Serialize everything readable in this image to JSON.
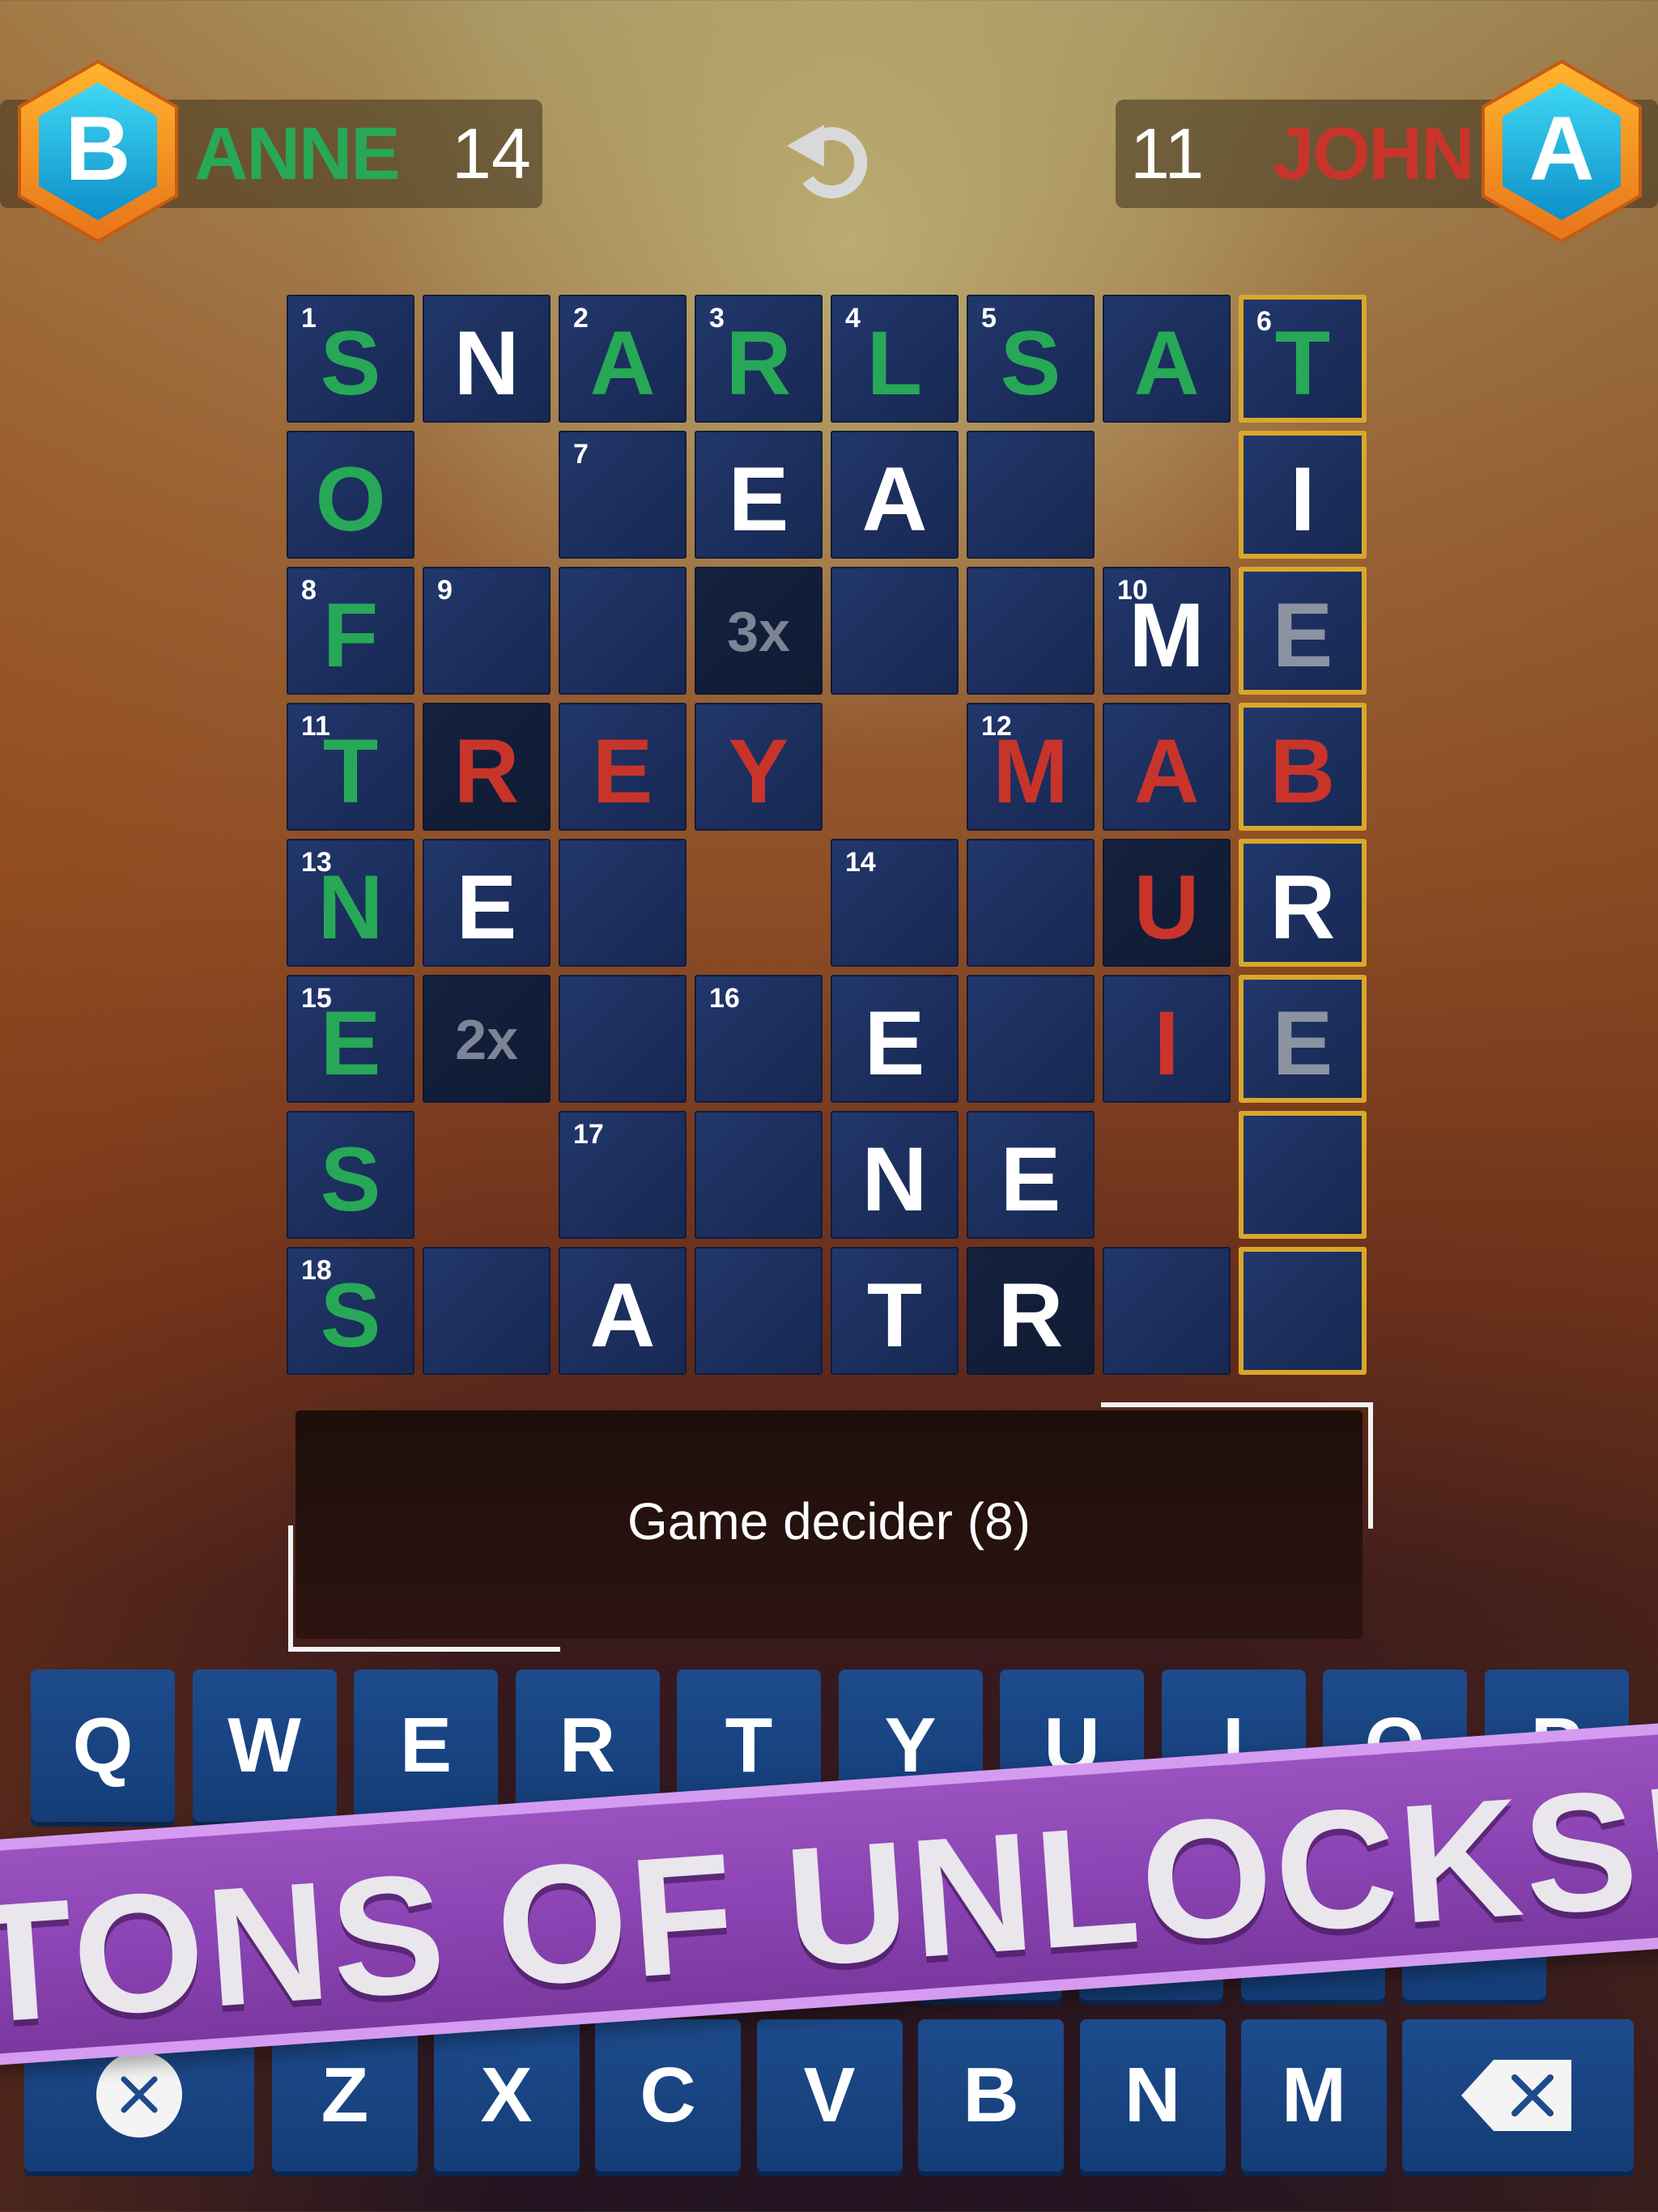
{
  "players": {
    "left": {
      "badge": "B",
      "name": "ANNE",
      "score": "14",
      "color": "#27a857"
    },
    "right": {
      "badge": "A",
      "name": "JOHN",
      "score": "11",
      "color": "#c8342a"
    }
  },
  "colors": {
    "green": "#27a857",
    "red": "#c8342a",
    "white": "#ffffff",
    "grey": "#8b93a1",
    "gold": "#d8a829"
  },
  "undo_icon": "undo-icon",
  "grid": {
    "cols": 8,
    "rows": 8,
    "cells": [
      {
        "r": 0,
        "c": 0,
        "num": "1",
        "letter": "S",
        "color": "green"
      },
      {
        "r": 0,
        "c": 1,
        "letter": "N",
        "color": "white"
      },
      {
        "r": 0,
        "c": 2,
        "num": "2",
        "letter": "A",
        "color": "green"
      },
      {
        "r": 0,
        "c": 3,
        "num": "3",
        "letter": "R",
        "color": "green"
      },
      {
        "r": 0,
        "c": 4,
        "num": "4",
        "letter": "L",
        "color": "green"
      },
      {
        "r": 0,
        "c": 5,
        "num": "5",
        "letter": "S",
        "color": "green"
      },
      {
        "r": 0,
        "c": 6,
        "letter": "A",
        "color": "green"
      },
      {
        "r": 0,
        "c": 7,
        "num": "6",
        "letter": "T",
        "color": "green",
        "gold": true
      },
      {
        "r": 1,
        "c": 0,
        "letter": "O",
        "color": "green"
      },
      {
        "r": 1,
        "c": 2,
        "num": "7"
      },
      {
        "r": 1,
        "c": 3,
        "letter": "E",
        "color": "white"
      },
      {
        "r": 1,
        "c": 4,
        "letter": "A",
        "color": "white"
      },
      {
        "r": 1,
        "c": 5
      },
      {
        "r": 1,
        "c": 7,
        "letter": "I",
        "color": "white",
        "gold": true
      },
      {
        "r": 2,
        "c": 0,
        "num": "8",
        "letter": "F",
        "color": "green"
      },
      {
        "r": 2,
        "c": 1,
        "num": "9"
      },
      {
        "r": 2,
        "c": 2
      },
      {
        "r": 2,
        "c": 3,
        "bonus": "3x",
        "dark": true
      },
      {
        "r": 2,
        "c": 4
      },
      {
        "r": 2,
        "c": 5
      },
      {
        "r": 2,
        "c": 6,
        "num": "10",
        "letter": "M",
        "color": "white"
      },
      {
        "r": 2,
        "c": 7,
        "letter": "E",
        "color": "grey",
        "gold": true
      },
      {
        "r": 3,
        "c": 0,
        "num": "11",
        "letter": "T",
        "color": "green"
      },
      {
        "r": 3,
        "c": 1,
        "letter": "R",
        "color": "red",
        "dark": true
      },
      {
        "r": 3,
        "c": 2,
        "letter": "E",
        "color": "red"
      },
      {
        "r": 3,
        "c": 3,
        "letter": "Y",
        "color": "red"
      },
      {
        "r": 3,
        "c": 5,
        "num": "12",
        "letter": "M",
        "color": "red"
      },
      {
        "r": 3,
        "c": 6,
        "letter": "A",
        "color": "red"
      },
      {
        "r": 3,
        "c": 7,
        "letter": "B",
        "color": "red",
        "gold": true
      },
      {
        "r": 4,
        "c": 0,
        "num": "13",
        "letter": "N",
        "color": "green"
      },
      {
        "r": 4,
        "c": 1,
        "letter": "E",
        "color": "white"
      },
      {
        "r": 4,
        "c": 2
      },
      {
        "r": 4,
        "c": 4,
        "num": "14"
      },
      {
        "r": 4,
        "c": 5
      },
      {
        "r": 4,
        "c": 6,
        "letter": "U",
        "color": "red",
        "dark": true
      },
      {
        "r": 4,
        "c": 7,
        "letter": "R",
        "color": "white",
        "gold": true
      },
      {
        "r": 5,
        "c": 0,
        "num": "15",
        "letter": "E",
        "color": "green"
      },
      {
        "r": 5,
        "c": 1,
        "bonus": "2x",
        "dark": true
      },
      {
        "r": 5,
        "c": 2
      },
      {
        "r": 5,
        "c": 3,
        "num": "16"
      },
      {
        "r": 5,
        "c": 4,
        "letter": "E",
        "color": "white"
      },
      {
        "r": 5,
        "c": 5
      },
      {
        "r": 5,
        "c": 6,
        "letter": "I",
        "color": "red"
      },
      {
        "r": 5,
        "c": 7,
        "letter": "E",
        "color": "grey",
        "gold": true
      },
      {
        "r": 6,
        "c": 0,
        "letter": "S",
        "color": "green"
      },
      {
        "r": 6,
        "c": 2,
        "num": "17"
      },
      {
        "r": 6,
        "c": 3
      },
      {
        "r": 6,
        "c": 4,
        "letter": "N",
        "color": "white"
      },
      {
        "r": 6,
        "c": 5,
        "letter": "E",
        "color": "white"
      },
      {
        "r": 6,
        "c": 7,
        "gold": true
      },
      {
        "r": 7,
        "c": 0,
        "num": "18",
        "letter": "S",
        "color": "green"
      },
      {
        "r": 7,
        "c": 1
      },
      {
        "r": 7,
        "c": 2,
        "letter": "A",
        "color": "white"
      },
      {
        "r": 7,
        "c": 3
      },
      {
        "r": 7,
        "c": 4,
        "letter": "T",
        "color": "white"
      },
      {
        "r": 7,
        "c": 5,
        "letter": "R",
        "color": "white",
        "dark": true
      },
      {
        "r": 7,
        "c": 6
      },
      {
        "r": 7,
        "c": 7,
        "gold": true
      }
    ]
  },
  "clue": {
    "text": "Game decider (8)"
  },
  "keyboard": {
    "row1": [
      "Q",
      "W",
      "E",
      "R",
      "T",
      "Y",
      "U",
      "I",
      "O",
      "P"
    ],
    "row3": [
      "Z",
      "X",
      "C",
      "V",
      "B",
      "N",
      "M"
    ],
    "clear_icon": "clear-x-icon",
    "backspace_icon": "backspace-icon"
  },
  "banner": {
    "text": "TONS OF UNLOCKS!"
  }
}
